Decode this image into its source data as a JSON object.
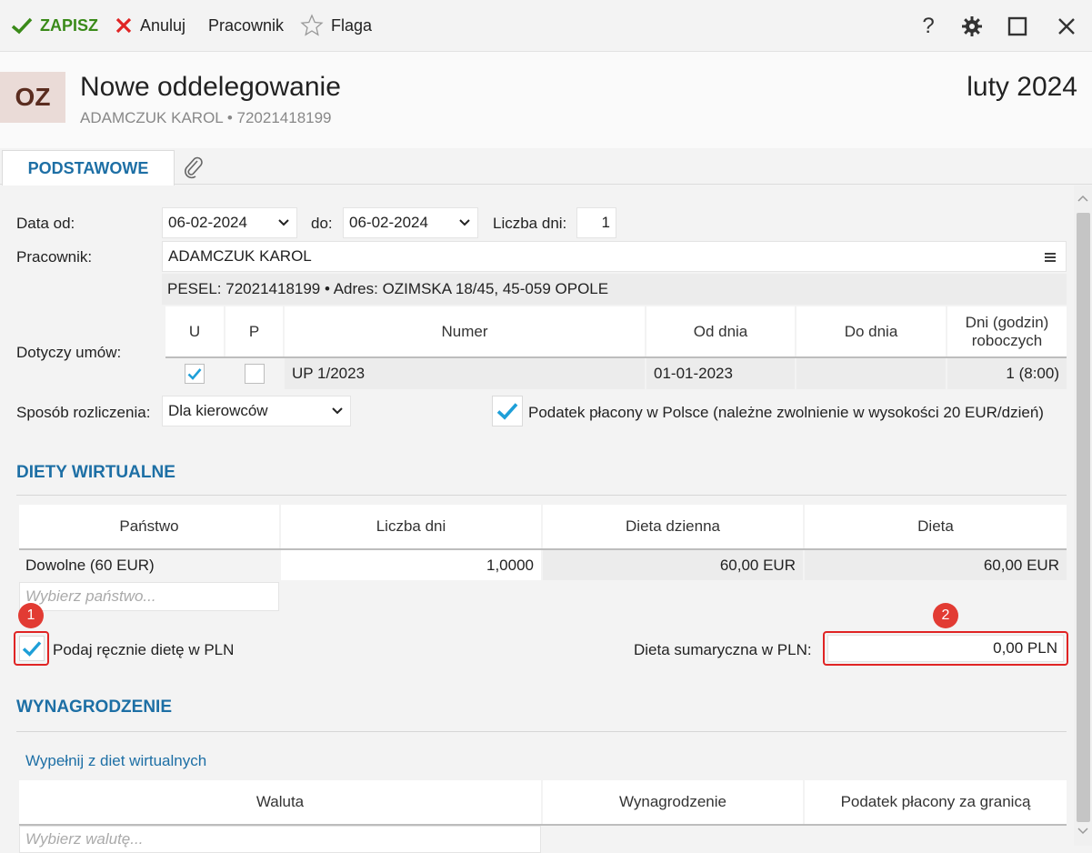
{
  "toolbar": {
    "save_label": "ZAPISZ",
    "cancel_label": "Anuluj",
    "employee_label": "Pracownik",
    "flag_label": "Flaga"
  },
  "header": {
    "initials": "OZ",
    "title": "Nowe oddelegowanie",
    "subtitle": "ADAMCZUK KAROL  •  72021418199",
    "period": "luty 2024"
  },
  "tabs": {
    "basic": "PODSTAWOWE"
  },
  "form": {
    "date_from_label": "Data od:",
    "date_from": "06-02-2024",
    "date_to_label": "do:",
    "date_to": "06-02-2024",
    "days_label": "Liczba dni:",
    "days": "1",
    "employee_label": "Pracownik:",
    "employee": "ADAMCZUK KAROL",
    "employee_details": "PESEL:  72021418199  •  Adres:  OZIMSKA 18/45, 45-059 OPOLE",
    "contracts_label": "Dotyczy umów:",
    "contracts_headers": [
      "U",
      "P",
      "Numer",
      "Od dnia",
      "Do dnia",
      "Dni (godzin) roboczych"
    ],
    "contract_row": {
      "u_checked": true,
      "p_checked": false,
      "number": "UP 1/2023",
      "from": "01-01-2023",
      "to": "",
      "days": "1  (8:00)"
    },
    "settlement_label": "Sposób rozliczenia:",
    "settlement": "Dla kierowców",
    "tax_poland_label": "Podatek płacony w Polsce (należne zwolnienie w wysokości 20 EUR/dzień)"
  },
  "virtual_diets": {
    "title": "DIETY WIRTUALNE",
    "headers": [
      "Państwo",
      "Liczba dni",
      "Dieta dzienna",
      "Dieta"
    ],
    "row": {
      "country": "Dowolne (60 EUR)",
      "days": "1,0000",
      "daily": "60,00 EUR",
      "total": "60,00 EUR"
    },
    "country_placeholder": "Wybierz państwo...",
    "manual_pln_label": "Podaj ręcznie dietę w PLN",
    "sum_pln_label": "Dieta sumaryczna w PLN:",
    "sum_pln": "0,00 PLN",
    "badge1": "1",
    "badge2": "2"
  },
  "salary": {
    "title": "WYNAGRODZENIE",
    "fill_link": "Wypełnij z diet wirtualnych",
    "headers": [
      "Waluta",
      "Wynagrodzenie",
      "Podatek płacony za granicą"
    ],
    "currency_placeholder": "Wybierz walutę..."
  }
}
